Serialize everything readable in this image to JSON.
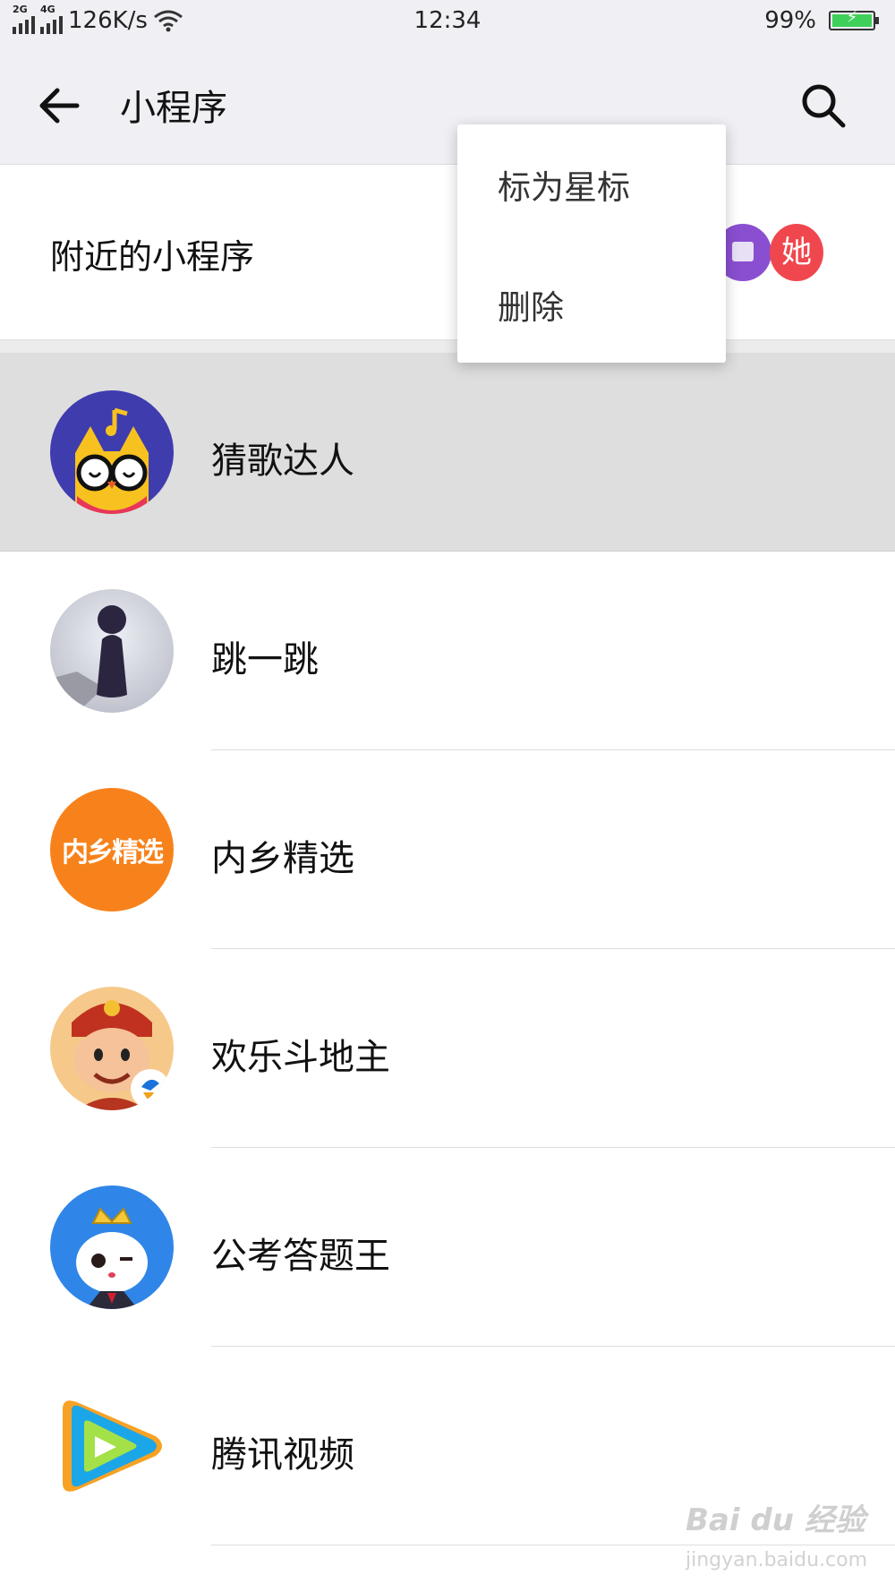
{
  "status_bar": {
    "net1": "2G",
    "net2": "4G",
    "speed": "126K/s",
    "time": "12:34",
    "battery": "99%"
  },
  "header": {
    "title": "小程序",
    "back_icon": "arrow-left-icon",
    "search_icon": "search-icon"
  },
  "nearby": {
    "label": "附近的小程序",
    "avatar2_text": "她"
  },
  "menu": {
    "items": [
      "标为星标",
      "删除"
    ]
  },
  "apps": [
    {
      "name": "猜歌达人",
      "selected": true
    },
    {
      "name": "跳一跳"
    },
    {
      "name": "内乡精选",
      "icon_text": "内乡精选"
    },
    {
      "name": "欢乐斗地主"
    },
    {
      "name": "公考答题王"
    },
    {
      "name": "腾讯视频"
    }
  ],
  "watermark": {
    "line1": "Bai du 经验",
    "line2": "jingyan.baidu.com"
  },
  "colors": {
    "header_bg": "#efeff4",
    "selected_row": "#dedede",
    "battery_green": "#3fd05a"
  }
}
